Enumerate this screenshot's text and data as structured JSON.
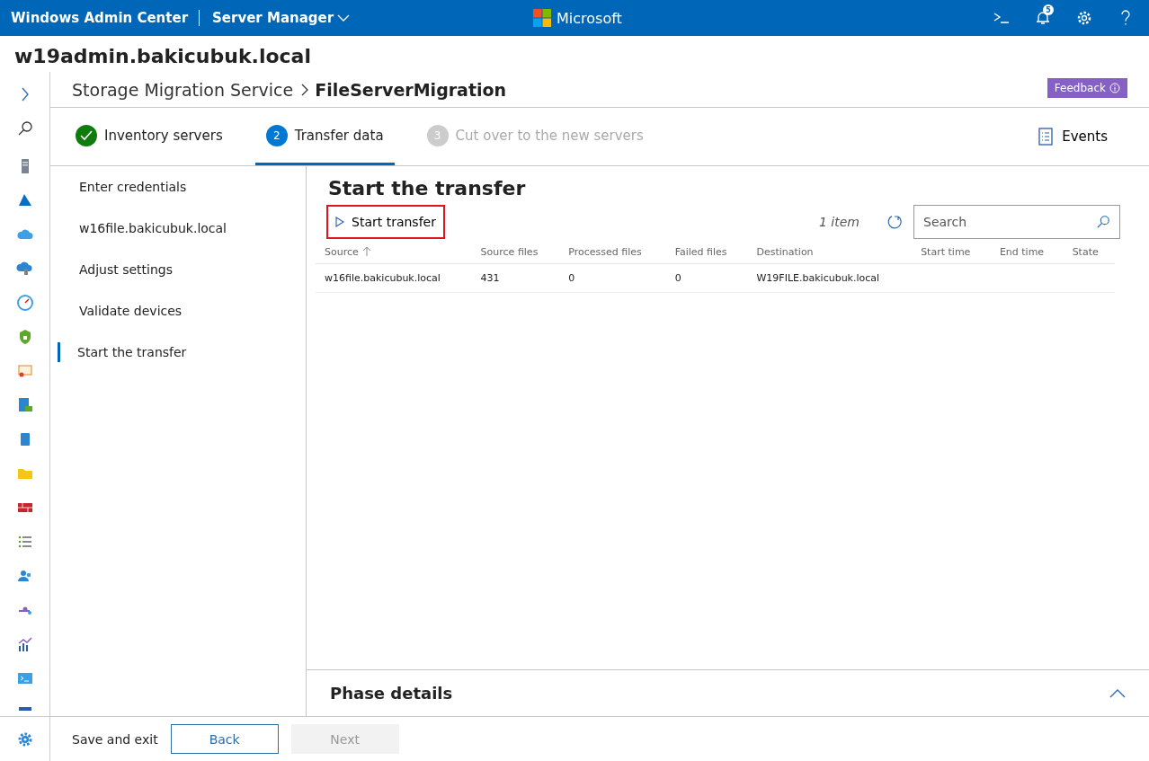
{
  "header": {
    "app_title": "Windows Admin Center",
    "context": "Server Manager",
    "brand": "Microsoft",
    "notification_count": "5"
  },
  "server_name": "w19admin.bakicubuk.local",
  "breadcrumb": {
    "parent": "Storage Migration Service",
    "current": "FileServerMigration"
  },
  "feedback": "Feedback",
  "steps": [
    {
      "kind": "done",
      "label": "Inventory servers",
      "selected": false
    },
    {
      "kind": "active",
      "number": "2",
      "label": "Transfer data",
      "selected": true
    },
    {
      "kind": "pending",
      "number": "3",
      "label": "Cut over to the new servers",
      "selected": false
    }
  ],
  "events": "Events",
  "nav": [
    {
      "label": "Enter credentials",
      "selected": false
    },
    {
      "label": "w16file.bakicubuk.local",
      "selected": false
    },
    {
      "label": "Adjust settings",
      "selected": false
    },
    {
      "label": "Validate devices",
      "selected": false
    },
    {
      "label": "Start the transfer",
      "selected": true
    }
  ],
  "main": {
    "title": "Start the transfer",
    "action": {
      "label": "Start transfer",
      "highlighted": true
    },
    "count": "1 item",
    "search": {
      "placeholder": "Search"
    }
  },
  "table": {
    "columns": [
      {
        "label": "Source",
        "sorted": true
      },
      {
        "label": "Source files",
        "sorted": false
      },
      {
        "label": "Processed files",
        "sorted": false
      },
      {
        "label": "Failed files",
        "sorted": false
      },
      {
        "label": "Destination",
        "sorted": false
      },
      {
        "label": "Start time",
        "sorted": false
      },
      {
        "label": "End time",
        "sorted": false
      },
      {
        "label": "State",
        "sorted": false
      }
    ],
    "rows": [
      [
        "w16file.bakicubuk.local",
        "431",
        "0",
        "0",
        "W19FILE.bakicubuk.local",
        "",
        "",
        ""
      ]
    ]
  },
  "phase_details": {
    "title": "Phase details",
    "expanded": true
  },
  "footer": {
    "save": "Save and exit",
    "back": {
      "label": "Back",
      "disabled": false
    },
    "next": {
      "label": "Next",
      "disabled": true
    }
  }
}
